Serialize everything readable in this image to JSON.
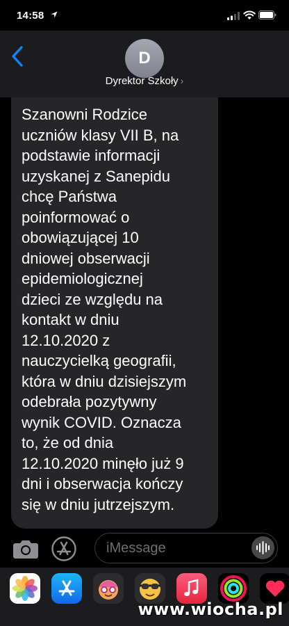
{
  "status_bar": {
    "time": "14:58",
    "icons": [
      "location-arrow-icon",
      "cellular-signal-icon",
      "wifi-icon",
      "battery-icon"
    ]
  },
  "header": {
    "avatar_letter": "D",
    "contact_name": "Dyrektor Szkoły",
    "contact_chevron": "›",
    "back_icon": "chevron-left-icon"
  },
  "conversation": {
    "messages": [
      {
        "direction": "incoming",
        "text": "Szanowni Rodzice\nuczniów klasy VII B, na\npodstawie informacji\nuzyskanej z Sanepidu\nchcę Państwa\npoinformować o\nobowiązującej 10\ndniowej obserwacji\nepidemiologicznej\ndzieci ze względu na\nkontakt w dniu\n12.10.2020 z\nnauczycielką geografii,\nktóra w dniu dzisiejszym\nodebrała pozytywny\nwynik COVID. Oznacza\nto, że od dnia\n12.10.2020 minęło już 9\ndni i obserwacja kończy\nsię w dniu jutrzejszym."
      }
    ]
  },
  "input_bar": {
    "placeholder": "iMessage",
    "icons": [
      "camera-icon",
      "app-store-icon",
      "audio-waveform-icon"
    ]
  },
  "app_drawer": {
    "apps": [
      "photos-icon",
      "app-store-icon",
      "memoji-icon",
      "animoji-icon",
      "music-icon",
      "activity-icon",
      "digital-touch-icon"
    ]
  },
  "watermark": "www.wiocha.pl",
  "colors": {
    "background": "#000000",
    "header": "#1c1c1e",
    "bubble": "#262629",
    "accent_blue": "#0a84ff",
    "placeholder_gray": "#6d6d72"
  }
}
